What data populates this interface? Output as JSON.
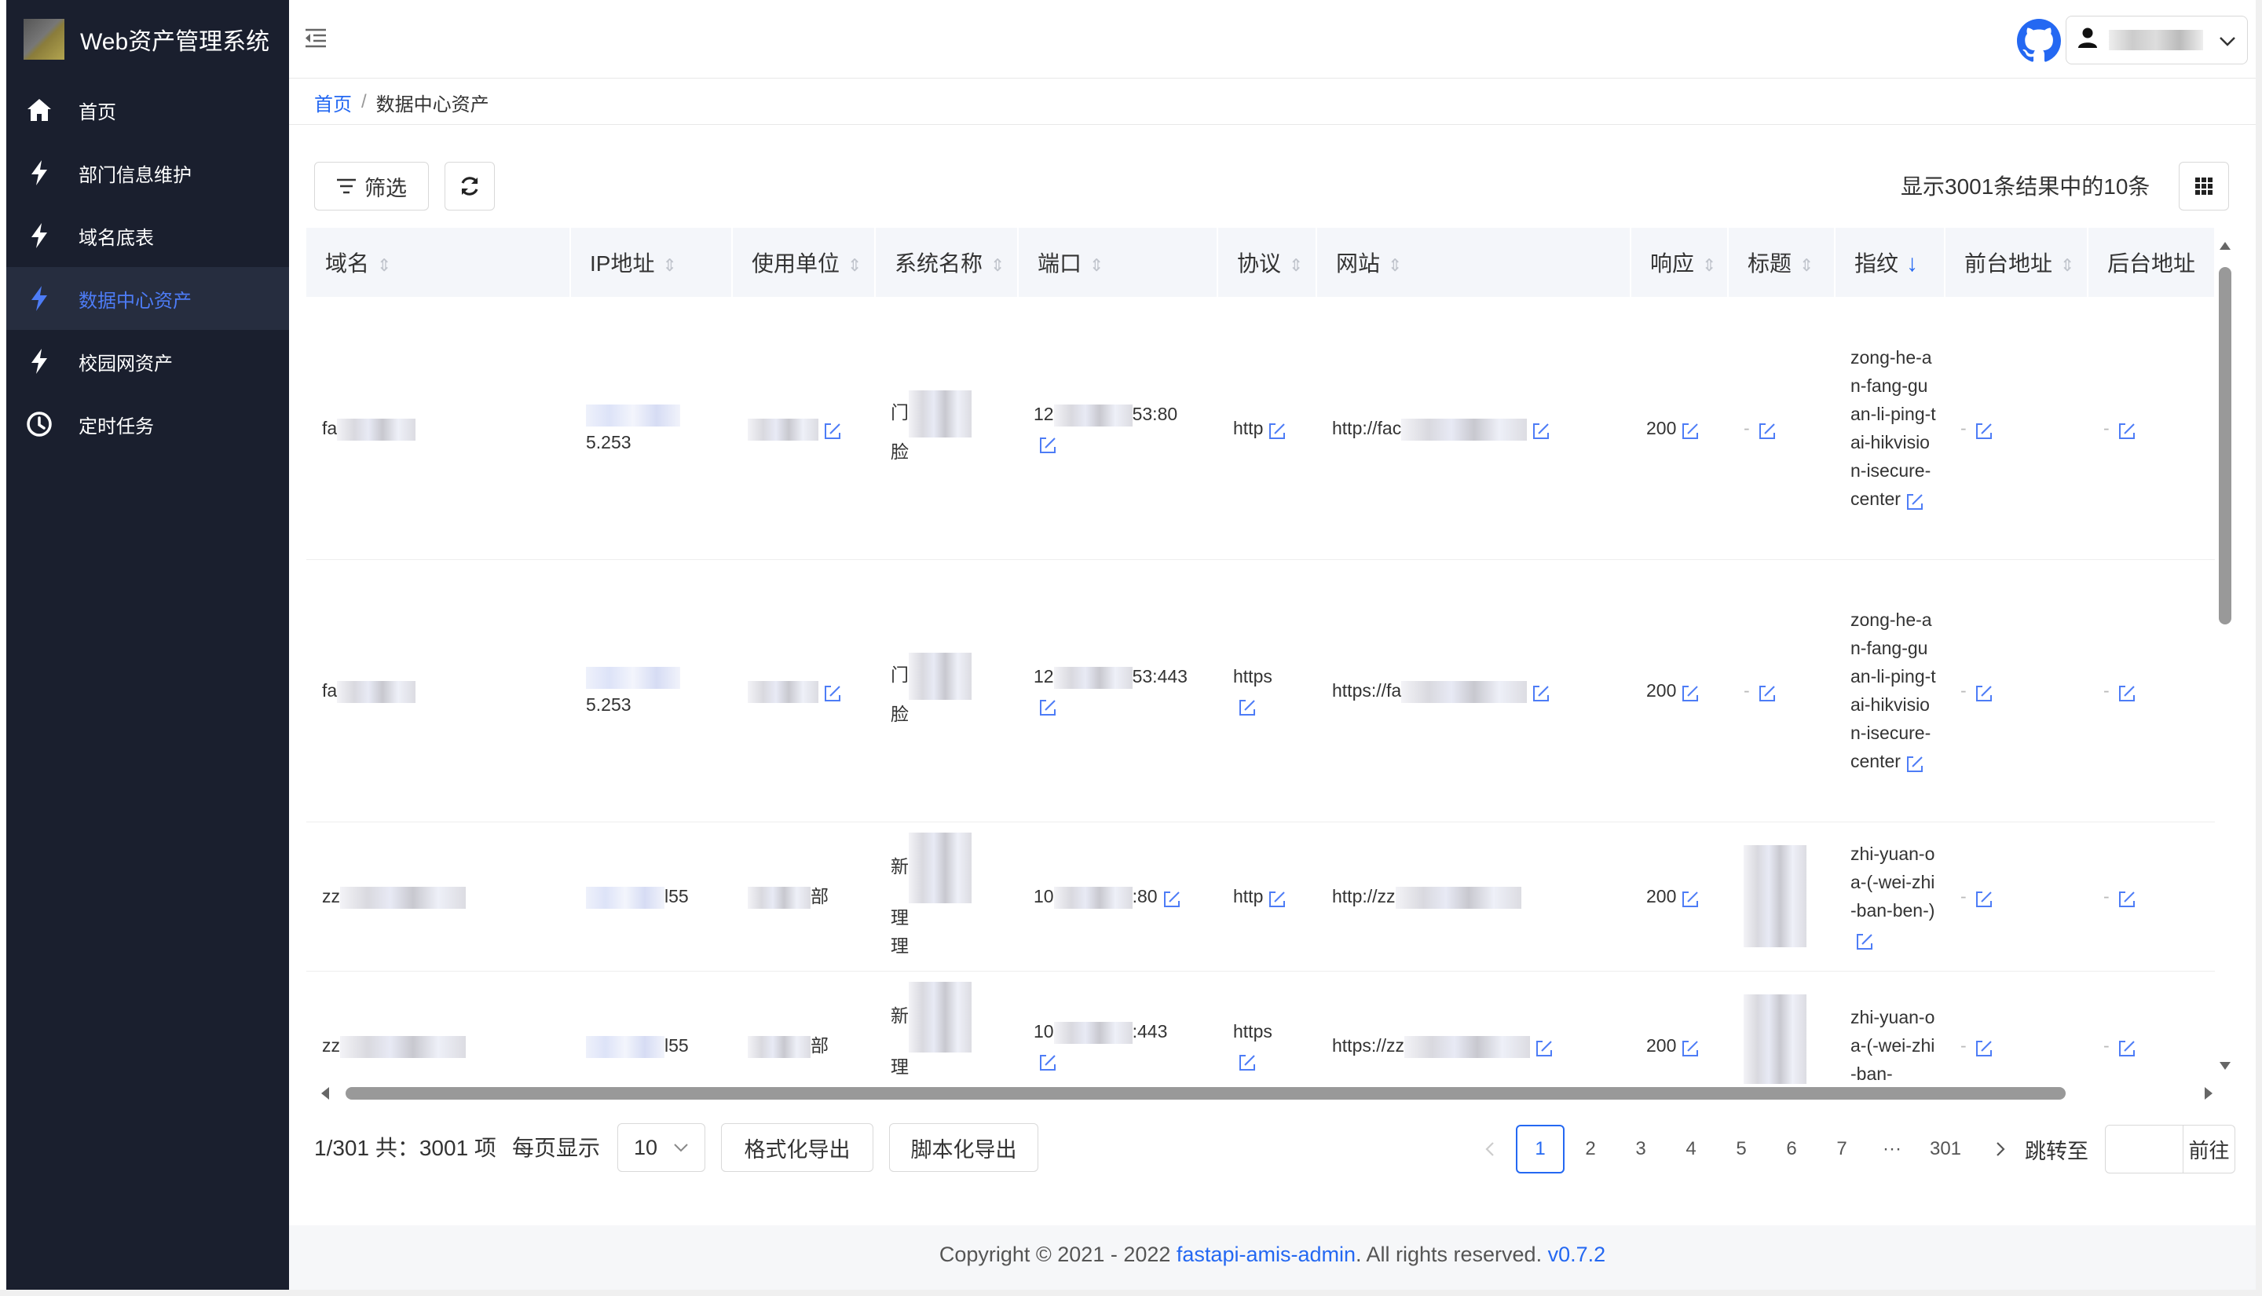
{
  "app": {
    "title": "Web资产管理系统"
  },
  "sidebar": {
    "items": [
      {
        "label": "首页",
        "icon": "home-icon"
      },
      {
        "label": "部门信息维护",
        "icon": "bolt-icon"
      },
      {
        "label": "域名底表",
        "icon": "bolt-icon"
      },
      {
        "label": "数据中心资产",
        "icon": "bolt-icon",
        "active": true
      },
      {
        "label": "校园网资产",
        "icon": "bolt-icon"
      },
      {
        "label": "定时任务",
        "icon": "clock-icon"
      }
    ]
  },
  "breadcrumb": {
    "home": "首页",
    "sep": "/",
    "current": "数据中心资产"
  },
  "toolbar": {
    "filter_label": "筛选",
    "result_text": "显示3001条结果中的10条"
  },
  "table": {
    "columns": [
      "域名",
      "IP地址",
      "使用单位",
      "系统名称",
      "端口",
      "协议",
      "网站",
      "响应",
      "标题",
      "指纹",
      "前台地址",
      "后台地址"
    ],
    "rows": [
      {
        "domain": "fa",
        "ip": "5.253",
        "unit": "",
        "system_a": "门",
        "system_b": "脸",
        "port_a": "12",
        "port_b": "53:80",
        "protocol": "http",
        "site": "http://fac",
        "status": "200",
        "title": "-",
        "fingerprint": "zong-he-an-fang-guan-li-ping-tai-hikvision-isecure-center",
        "front": "-",
        "back": "-"
      },
      {
        "domain": "fa",
        "ip": "5.253",
        "unit": "",
        "system_a": "门",
        "system_b": "脸",
        "port_a": "12",
        "port_b": "53:443",
        "protocol": "https",
        "site": "https://fa",
        "status": "200",
        "title": "-",
        "fingerprint": "zong-he-an-fang-guan-li-ping-tai-hikvision-isecure-center",
        "front": "-",
        "back": "-"
      },
      {
        "domain": "zz",
        "ip": "l55",
        "unit": "部",
        "system_a": "新",
        "system_b": "理",
        "system_c": "理",
        "port_a": "10",
        "port_b": ":80",
        "protocol": "http",
        "site": "http://zz",
        "status": "200",
        "title": "",
        "fingerprint": "zhi-yuan-oa-(-wei-zhi-ban-ben-)",
        "front": "-",
        "back": "-"
      },
      {
        "domain": "zz",
        "ip": "l55",
        "unit": "部",
        "system_a": "新",
        "system_b": "理",
        "system_c": "理",
        "port_a": "10",
        "port_b": ":443",
        "protocol": "https",
        "site": "https://zz",
        "status": "200",
        "title": "",
        "fingerprint": "zhi-yuan-oa-(-wei-zhi-ban-",
        "front": "-",
        "back": "-"
      }
    ]
  },
  "pagination": {
    "info": "1/301 共：3001 项",
    "per_page_label": "每页显示",
    "per_page_value": "10",
    "export_formatted": "格式化导出",
    "export_script": "脚本化导出",
    "pages": [
      "1",
      "2",
      "3",
      "4",
      "5",
      "6",
      "7",
      "···",
      "301"
    ],
    "current_page": "1",
    "jump_label": "跳转至",
    "go_label": "前往"
  },
  "footer": {
    "prefix": "Copyright © 2021 - 2022 ",
    "link": "fastapi-amis-admin",
    "middle": ". All rights reserved. ",
    "version": "v0.7.2"
  },
  "colors": {
    "sidebar_bg": "#1a1f2e",
    "accent": "#2468f2",
    "header_bg": "#f4f6fa"
  }
}
